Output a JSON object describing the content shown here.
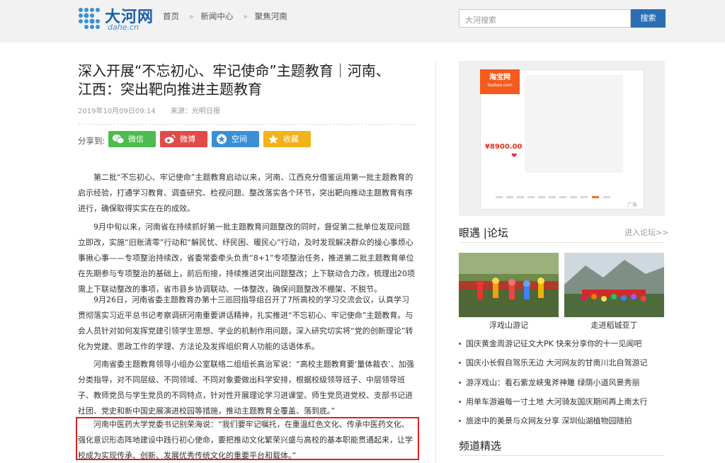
{
  "header": {
    "logo_text": "大河网",
    "logo_sub": "dahe.cn",
    "breadcrumb": [
      "首页",
      "新闻中心",
      "聚焦河南"
    ],
    "breadcrumb_sep": "»",
    "search_placeholder": "大河搜索",
    "search_button": "搜索"
  },
  "article": {
    "title": "深入开展“不忘初心、牢记使命”主题教育｜河南、江西：突出靶向推进主题教育",
    "date": "2019年10月09日09:14",
    "source": "来源：光明日报",
    "share_label": "分享到:",
    "share_buttons": [
      "微信",
      "微博",
      "空间",
      "收藏"
    ],
    "paragraphs": [
      "第二批“不忘初心、牢记使命”主题教育启动以来，河南、江西充分借鉴运用第一批主题教育的启示经验，打通学习教育、调查研究、检视问题、整改落实各个环节，突出靶向推动主题教育有序进行，确保取得实实在在的成效。",
      "9月中旬以来，河南省在持续抓好第一批主题教育问题整改的同时，督促第二批单位发现问题立即改，实施“旧账清零”行动和“解民忧、纾民困、暖民心”行动，及时发现解决群众的操心事烦心事揪心事——专项整治持续改，省委常委牵头负责“8+1”专项整治任务，推进第二批主题教育单位在先期参与专项整治的基础上，前后衔接，持续推进突出问题整改；上下联动合力改，梳理出20项需上下联动整改的事项，省市县乡协调联动、一体整改，确保问题整改不棚架、不脱节。",
      "9月26日，河南省委主题教育办第十三巡回指导组召开了7所高校的学习交流会议，认真学习贯彻落实习近平总书记考察调研河南重要讲话精神，扎实推进“不忘初心、牢记使命”主题教育。与会人员针对如何发挥党建引领学生思想、学业的机制作用问题，深入研究切实将“党的创新理论”转化为党建、思政工作的学理、方法论及发挥组织育人功能的话语体系。",
      "河南省委主题教育领导小组办公室联络二组组长高治军说：“高校主题教育要‘量体裁衣’、加强分类指导，对不同层级、不同领域、不同对象要做出科学安排，根据校级领导班子、中层领导班子、教师党员与学生党员的不同特点，针对性开展理论学习进课堂、师生党员进党校、支部书记进社团、党史和新中国史展演进校园等措施，推动主题教育全覆盖、落到底。”",
      "河南中医药大学党委书记别荣海说：“我们要牢记嘱托，在重温红色文化、传承中医药文化、强化意识形态阵地建设中践行初心使命，要把推动文化繁荣兴盛与高校的基本职能贯通起来，让学校成为实现传承、创新、发展优秀传统文化的重要平台和载体。”"
    ]
  },
  "ad": {
    "brand": "淘宝网",
    "brand_sub": "Taobao.com",
    "price": "¥8900.00",
    "tag": "广告"
  },
  "sidebar": {
    "section1_title": "眼遇 |论坛",
    "section1_more": "进入论坛>>",
    "photos": [
      {
        "caption": "浮戏山游记"
      },
      {
        "caption": "走进稻城亚丁"
      }
    ],
    "news": [
      "国庆黄金周游记征文大PK 快来分享你的十一见闻吧",
      "国庆小长假自驾乐无边 大河网友的甘南川北自驾游记",
      "游浮戏山：看石紫龙峡鬼斧神雕 绿荫小道风景秀丽",
      "用单车游遍每一寸土地 大河骑友国庆期间再上南太行",
      "旅途中的美景与众网友分享 深圳仙湖植物园随拍"
    ],
    "section2_title": "频道精选"
  },
  "colors": {
    "brand_blue": "#1b5fa6",
    "search_button": "#2b6fb3",
    "wechat": "#4dbb4d",
    "weibo": "#e24a4a",
    "qzone": "#3c8fd6",
    "favorite": "#f2b21a",
    "highlight_border": "#e02020"
  }
}
